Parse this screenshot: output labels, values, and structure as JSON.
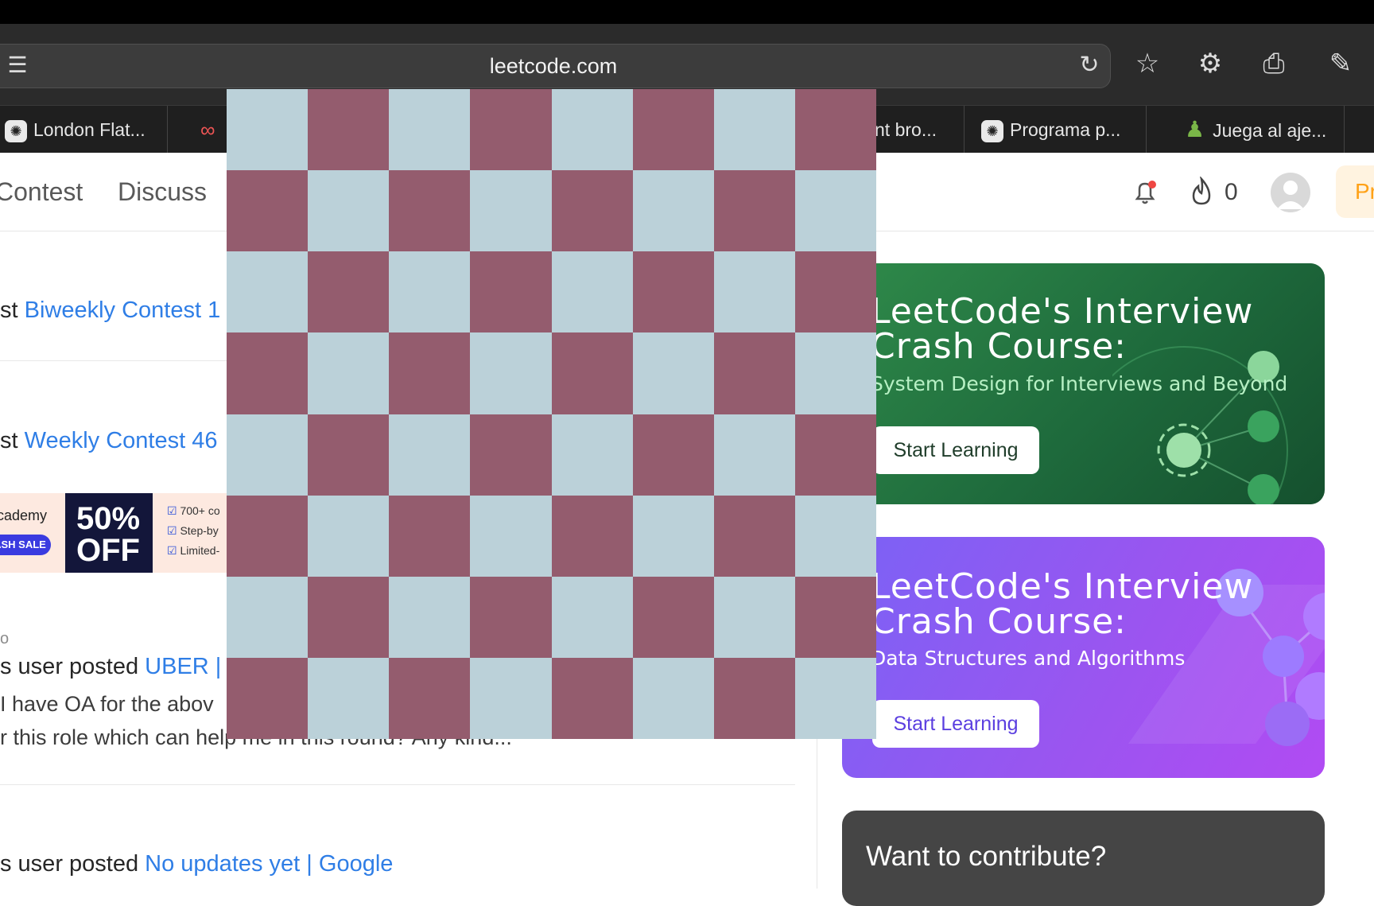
{
  "browser": {
    "url": "leetcode.com",
    "tabs": [
      {
        "label": "London Flat...",
        "icon": "chatgpt-icon"
      },
      {
        "label": "",
        "icon": "infinity-icon"
      },
      {
        "label": "nt bro...",
        "icon": ""
      },
      {
        "label": "Programa p...",
        "icon": "chatgpt-icon"
      },
      {
        "label": "Juega al aje...",
        "icon": "chess-pawn-icon"
      }
    ]
  },
  "nav": {
    "items": [
      "Contest",
      "Discuss"
    ],
    "streak_count": "0",
    "premium_label": "Pr"
  },
  "feed": {
    "items": [
      {
        "prefix": "st",
        "link": "Biweekly Contest 1"
      },
      {
        "prefix": "st",
        "link": "Weekly Contest 46"
      },
      {
        "prefix": "s user posted",
        "link": "UBER | S",
        "body_line1": "I have OA for the abov",
        "body_line2": "r this role which can help me in this round? Any kind..."
      },
      {
        "prefix": "s user posted",
        "link": "No updates yet | Google"
      }
    ],
    "ad": {
      "brand": "cademy",
      "sale": "ASH SALE",
      "discount": "50%",
      "off": "OFF",
      "checks": [
        "700+ co",
        "Step-by",
        "Limited-"
      ]
    },
    "small_marker": "o"
  },
  "sidebar": {
    "cards": [
      {
        "title_line1": "LeetCode's Interview",
        "title_line2": "Crash Course:",
        "subtitle": "System Design for Interviews and Beyond",
        "button": "Start Learning"
      },
      {
        "title_line1": "LeetCode's Interview",
        "title_line2": "Crash Course:",
        "subtitle": "Data Structures and Algorithms",
        "button": "Start Learning"
      }
    ],
    "contribute_title": "Want to contribute?"
  },
  "colors": {
    "link": "#2f7ee6",
    "checker_light": "#bbd1d9",
    "checker_dark": "#945c6e",
    "premium": "#ffa116"
  }
}
